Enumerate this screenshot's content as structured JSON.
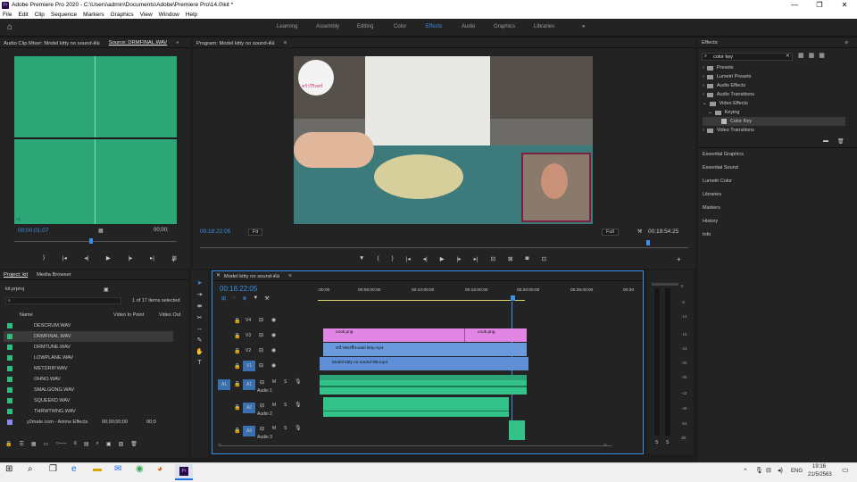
{
  "app": {
    "title": "Adobe Premiere Pro 2020 - C:\\Users\\admin\\Documents\\Adobe\\Premiere Pro\\14.0\\kit *",
    "logo": "Pr"
  },
  "menu": [
    "File",
    "Edit",
    "Clip",
    "Sequence",
    "Markers",
    "Graphics",
    "View",
    "Window",
    "Help"
  ],
  "workspaces": [
    "Learning",
    "Assembly",
    "Editing",
    "Color",
    "Effects",
    "Audio",
    "Graphics",
    "Libraries"
  ],
  "active_workspace": "Effects",
  "source": {
    "tab1": "Audio Clip Mixer: Model kitty no sound-ต่อ",
    "tab2": "Source: DRMFINAL.WAV",
    "timecode_left": "00;00;01;07",
    "timecode_right": "00;00;",
    "marker": "+1"
  },
  "program": {
    "title": "Program: Model kitty no sound-ต่อ",
    "timecode": "00:18:22:05",
    "fit": "Fit",
    "quality": "Full",
    "duration": "00:19:54:25",
    "overlay_text": "ครัววีรินทร์"
  },
  "project": {
    "tab1": "Project: kit",
    "tab2": "Media Browser",
    "file": "kit.prproj",
    "count": "1 of 17 items selected",
    "columns": [
      "Name",
      "Video In Point",
      "Video Out"
    ],
    "items": [
      {
        "name": "DESCRUM.WAV",
        "color": "#2fbf7a"
      },
      {
        "name": "DRMFINAL.WAV",
        "color": "#2fbf7a"
      },
      {
        "name": "DRMTUNE.WAV",
        "color": "#2fbf7a"
      },
      {
        "name": "LOWPLANE.WAV",
        "color": "#2fbf7a"
      },
      {
        "name": "METDRIP.WAV",
        "color": "#2fbf7a"
      },
      {
        "name": "OHNO.WAV",
        "color": "#2fbf7a"
      },
      {
        "name": "SMALGONG.WAV",
        "color": "#2fbf7a"
      },
      {
        "name": "SQUEEKD.WAV",
        "color": "#2fbf7a"
      },
      {
        "name": "THRWTWNG.WAV",
        "color": "#2fbf7a"
      },
      {
        "name": "y2mate.com - Anime Effects",
        "color": "#8a8af0",
        "in": "00;00;00;00",
        "out": "00;0"
      }
    ]
  },
  "timeline": {
    "title": "Model kitty no sound-ต่อ",
    "timecode": "00:18:22:05",
    "ruler": [
      ":00:00",
      "00:05:00:00",
      "00:10:00:00",
      "00:15:00:00",
      "00:20:00:00",
      "00:25:00:00",
      "00:30"
    ],
    "tracks": [
      {
        "id": "V4",
        "name": ""
      },
      {
        "id": "V3",
        "name": ""
      },
      {
        "id": "V2",
        "name": ""
      },
      {
        "id": "V1",
        "name": ""
      },
      {
        "id": "A1",
        "name": "Audio 1"
      },
      {
        "id": "A2",
        "name": "Audio 2"
      },
      {
        "id": "A3",
        "name": "Audio 3"
      }
    ],
    "clips": {
      "v3a": "cook.png",
      "v3b": "cook.png",
      "v2": "หน้าสองที่model kitty.mp4",
      "v1": "Model kitty no sound-ต่อ.mp4"
    }
  },
  "meter_ticks": [
    "0",
    "-6",
    "-12",
    "-18",
    "-24",
    "-30",
    "-36",
    "-42",
    "-48",
    "-54",
    "dB"
  ],
  "meter_solo": [
    "S",
    "S"
  ],
  "effects": {
    "title": "Effects",
    "search": "color key",
    "tree": [
      {
        "label": "Presets",
        "level": 0
      },
      {
        "label": "Lumetri Presets",
        "level": 0
      },
      {
        "label": "Audio Effects",
        "level": 0
      },
      {
        "label": "Audio Transitions",
        "level": 0
      },
      {
        "label": "Video Effects",
        "level": 0
      },
      {
        "label": "Keying",
        "level": 1
      },
      {
        "label": "Color Key",
        "level": 2
      },
      {
        "label": "Video Transitions",
        "level": 0
      }
    ],
    "side_panels": [
      "Essential Graphics",
      "Essential Sound",
      "Lumetri Color",
      "Libraries",
      "Markers",
      "History",
      "Info"
    ]
  },
  "taskbar": {
    "lang": "ENG",
    "time": "19:16",
    "date": "21/5/2563"
  },
  "colors": {
    "accent": "#3a8ee6",
    "video_clip": "#5f8fd6",
    "graphic_clip": "#e286e6",
    "audio_clip": "#33c28a",
    "source_bg": "#2ea778"
  }
}
